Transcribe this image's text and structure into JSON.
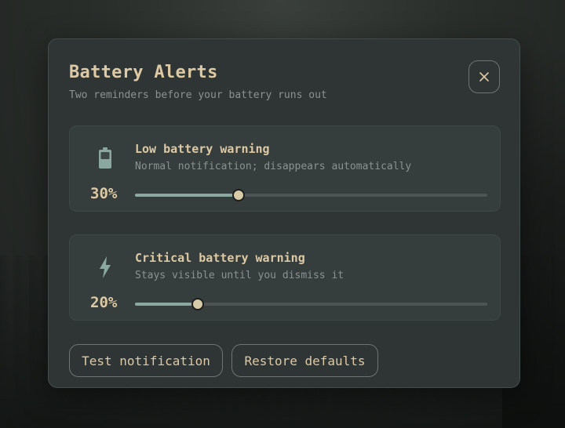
{
  "dialog": {
    "title": "Battery Alerts",
    "subtitle": "Two reminders before your battery runs out",
    "close_icon": "close-icon"
  },
  "alerts": [
    {
      "id": "low",
      "icon": "battery-low-icon",
      "title": "Low battery warning",
      "description": "Normal notification; disappears automatically",
      "value_label": "30%",
      "level_fraction": 0.295
    },
    {
      "id": "critical",
      "icon": "lightning-bolt-icon",
      "title": "Critical battery warning",
      "description": "Stays visible until you dismiss it",
      "value_label": "20%",
      "level_fraction": 0.178
    }
  ],
  "actions": {
    "test_label": "Test notification",
    "restore_label": "Restore defaults"
  },
  "colors": {
    "accent": "#ddc9a3",
    "slider_fill": "#8aa8a0",
    "thumb": "#d8cba7",
    "panel": "#2f3535",
    "card": "#363d3d",
    "muted_text": "#8c9291"
  }
}
